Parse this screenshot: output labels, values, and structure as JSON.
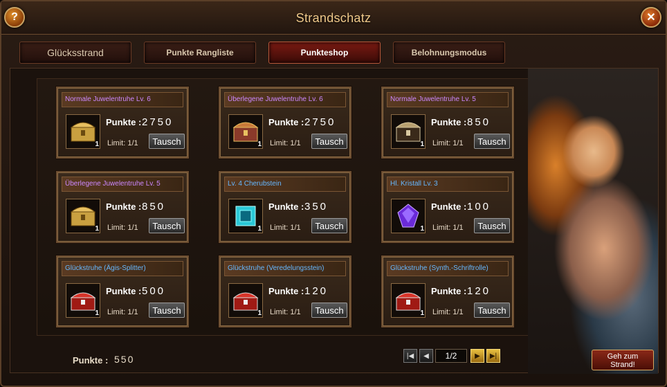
{
  "window": {
    "title": "Strandschatz",
    "help": "?",
    "close": "✕"
  },
  "tabs": [
    {
      "label": "Glücksstrand",
      "active": false
    },
    {
      "label": "Punkte Rangliste",
      "active": false
    },
    {
      "label": "Punkteshop",
      "active": true
    },
    {
      "label": "Belohnungsmodus",
      "active": false
    }
  ],
  "shop": {
    "points_label": "Punkte :",
    "limit_label": "Limit: 1/1",
    "exchange_label": "Tausch",
    "items": [
      {
        "name": "Normale Juwelentruhe Lv. 6",
        "name_color": "purple",
        "icon": "gold-chest-icon",
        "qty": "1",
        "points": "2750"
      },
      {
        "name": "Überlegene Juwelentruhe Lv. 6",
        "name_color": "purple",
        "icon": "ornate-chest-icon",
        "qty": "1",
        "points": "2750"
      },
      {
        "name": "Normale Juwelentruhe Lv. 5",
        "name_color": "purple",
        "icon": "silver-chest-icon",
        "qty": "1",
        "points": "850"
      },
      {
        "name": "Überlegene Juwelentruhe Lv. 5",
        "name_color": "purple",
        "icon": "gold-chest-icon",
        "qty": "1",
        "points": "850"
      },
      {
        "name": "Lv. 4 Cherubstein",
        "name_color": "blue",
        "icon": "cyan-gem-icon",
        "qty": "1",
        "points": "350"
      },
      {
        "name": "Hl. Kristall Lv. 3",
        "name_color": "blue",
        "icon": "purple-crystal-icon",
        "qty": "1",
        "points": "100"
      },
      {
        "name": "Glückstruhe (Ägis-Splitter)",
        "name_color": "blue",
        "icon": "red-chest-icon",
        "qty": "1",
        "points": "500"
      },
      {
        "name": "Glückstruhe (Veredelungsstein)",
        "name_color": "blue",
        "icon": "red-chest-icon",
        "qty": "1",
        "points": "120"
      },
      {
        "name": "Glückstruhe (Synth.-Schriftrolle)",
        "name_color": "blue",
        "icon": "red-chest-icon",
        "qty": "1",
        "points": "120"
      }
    ]
  },
  "footer": {
    "points_label": "Punkte :",
    "points_value": "550",
    "page": "1/2",
    "goto_line1": "Geh zum",
    "goto_line2": "Strand!"
  }
}
